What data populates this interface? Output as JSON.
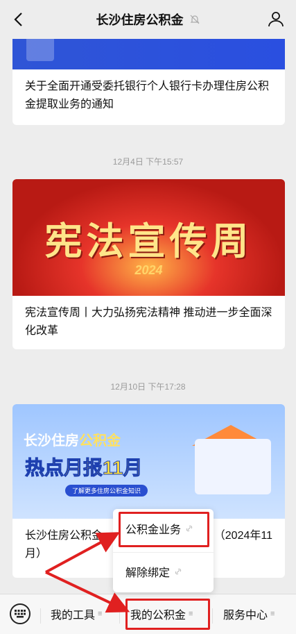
{
  "header": {
    "title": "长沙住房公积金"
  },
  "feed": {
    "card1_caption": "关于全面开通受委托银行个人银行卡办理住房公积金提取业务的通知",
    "time2": "12月4日 下午15:57",
    "card2_banner_text": "宪法宣传周",
    "card2_banner_year": "2024",
    "card2_caption": "宪法宣传周丨大力弘扬宪法精神 推动进一步全面深化改革",
    "time3": "12月10日 下午17:28",
    "card3_brand_a": "长沙住房",
    "card3_brand_b": "公积金",
    "card3_hot": "热点月报11月",
    "card3_learn": "了解更多住房公积金知识",
    "card3_caption_left": "长沙住房公积金",
    "card3_caption_right": "（2024年11",
    "card3_caption_line2": "月）"
  },
  "popup": {
    "items": [
      {
        "label": "公积金业务"
      },
      {
        "label": "解除绑定"
      }
    ]
  },
  "bottom_menu": {
    "items": [
      {
        "label": "我的工具"
      },
      {
        "label": "我的公积金"
      },
      {
        "label": "服务中心"
      }
    ]
  },
  "annotations": {
    "highlight_color": "#e02020"
  }
}
